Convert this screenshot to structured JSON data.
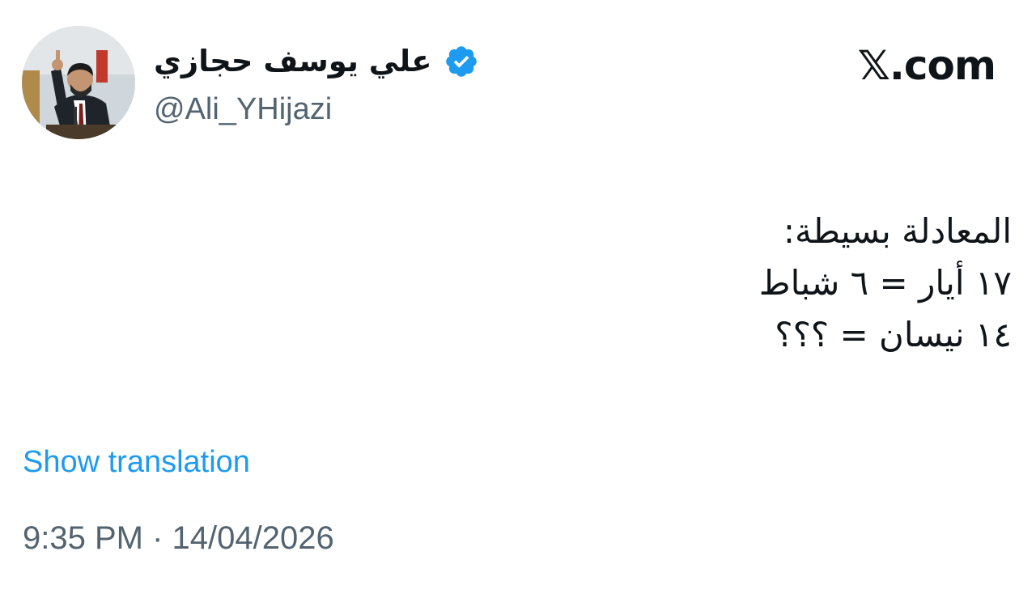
{
  "author": {
    "display_name": "علي يوسف حجازي",
    "handle": "@Ali_YHijazi",
    "verified_icon": "verified-badge-icon",
    "accent_color": "#1d9bf0"
  },
  "brand": {
    "text": "𝕏.com"
  },
  "tweet": {
    "lines": [
      "المعادلة بسيطة:",
      "١٧ أيار = ٦ شباط",
      "١٤ نيسان = ؟؟؟"
    ]
  },
  "actions": {
    "show_translation": "Show translation"
  },
  "meta": {
    "time": "9:35 PM",
    "separator": "·",
    "date": "14/04/2026"
  }
}
